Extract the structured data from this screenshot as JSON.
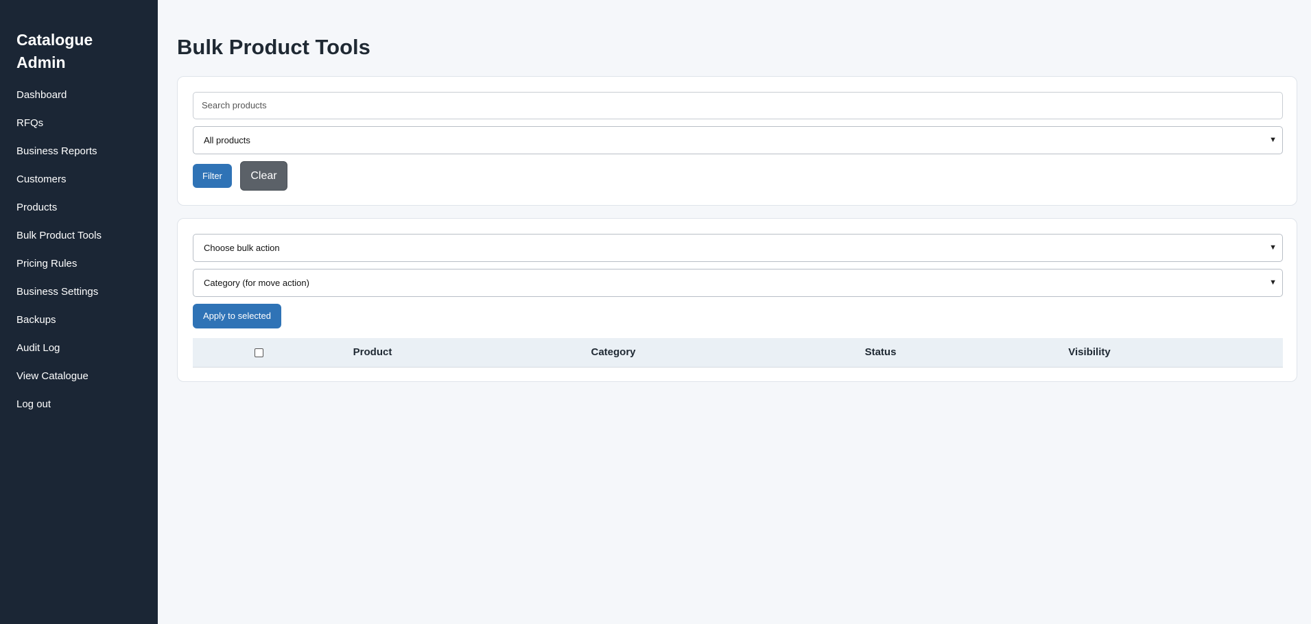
{
  "sidebar": {
    "brand": "Catalogue Admin",
    "items": [
      {
        "label": "Dashboard"
      },
      {
        "label": "RFQs"
      },
      {
        "label": "Business Reports"
      },
      {
        "label": "Customers"
      },
      {
        "label": "Products"
      },
      {
        "label": "Bulk Product Tools"
      },
      {
        "label": "Pricing Rules"
      },
      {
        "label": "Business Settings"
      },
      {
        "label": "Backups"
      },
      {
        "label": "Audit Log"
      },
      {
        "label": "View Catalogue"
      },
      {
        "label": "Log out"
      }
    ]
  },
  "page": {
    "title": "Bulk Product Tools"
  },
  "filter": {
    "search_placeholder": "Search products",
    "scope_selected": "All products",
    "filter_label": "Filter",
    "clear_label": "Clear"
  },
  "bulk": {
    "action_selected": "Choose bulk action",
    "category_selected": "Category (for move action)",
    "apply_label": "Apply to selected"
  },
  "table": {
    "columns": [
      "Product",
      "Category",
      "Status",
      "Visibility"
    ],
    "select_all_checked": false
  },
  "colors": {
    "sidebar_bg": "#1b2635",
    "primary": "#2f73b6",
    "secondary": "#5b6168",
    "page_bg": "#f5f7fa"
  }
}
